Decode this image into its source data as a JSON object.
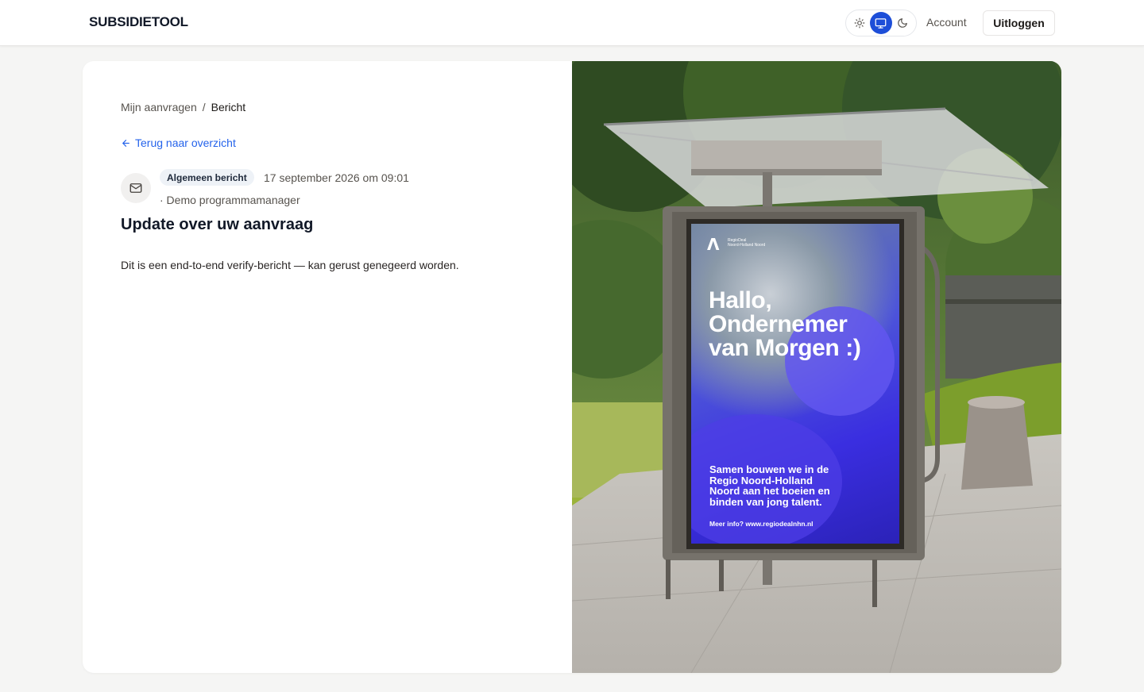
{
  "header": {
    "brand": "SUBSIDIETOOL",
    "theme_modes": [
      "sun-icon",
      "monitor-icon",
      "moon-icon"
    ],
    "active_theme": "monitor-icon",
    "account_label": "Account",
    "logout_label": "Uitloggen"
  },
  "breadcrumb": {
    "parent": "Mijn aanvragen",
    "separator": "/",
    "current": "Bericht"
  },
  "back_link": "Terug naar overzicht",
  "message": {
    "icon": "mail-icon",
    "category": "Algemeen bericht",
    "date": "17 september 2026 om 09:01",
    "sender": "· Demo programmamanager",
    "title": "Update over uw aanvraag",
    "body": "Dit is een end-to-end verify-bericht — kan gerust genegeerd worden."
  },
  "poster": {
    "logo_line1": "RegioDeal",
    "logo_line2": "Noord-Holland Noord",
    "headline_1": "Hallo,",
    "headline_2": "Ondernemer",
    "headline_3": "van Morgen :)",
    "sub_1": "Samen bouwen we in de",
    "sub_2": "Regio Noord-Holland",
    "sub_3": "Noord aan het boeien en",
    "sub_4": "binden van jong talent.",
    "info": "Meer info? www.regiodealnhn.nl"
  },
  "colors": {
    "accent": "#1d4ed8",
    "link": "#2563eb",
    "page_bg": "#f5f5f4"
  }
}
